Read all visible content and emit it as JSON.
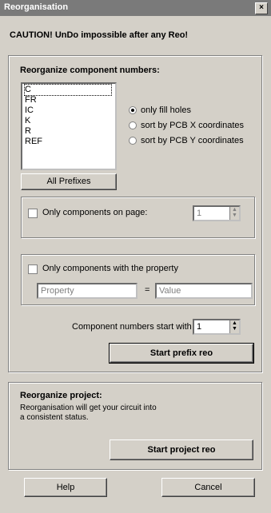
{
  "window": {
    "title": "Reorganisation",
    "close_symbol": "×"
  },
  "warning": "CAUTION! UnDo impossible after any Reo!",
  "component_numbers": {
    "title": "Reorganize component numbers:",
    "prefixes": [
      "C",
      "FR",
      "IC",
      "K",
      "R",
      "REF"
    ],
    "all_prefixes_label": "All Prefixes",
    "radio_options": [
      {
        "label": "only fill holes",
        "checked": true
      },
      {
        "label": "sort by PCB X coordinates",
        "checked": false
      },
      {
        "label": "sort by PCB Y coordinates",
        "checked": false
      }
    ],
    "only_on_page_label": "Only components on page:",
    "page_value": "1",
    "only_with_property_label": "Only components with the property",
    "property_placeholder": "Property",
    "equals": "=",
    "value_placeholder": "Value",
    "start_with_label": "Component numbers start with",
    "start_with_value": "1",
    "start_prefix_button": "Start prefix reo"
  },
  "project": {
    "title": "Reorganize project:",
    "description_line1": "Reorganisation will get your circuit into",
    "description_line2": "a consistent status.",
    "start_project_button": "Start project reo"
  },
  "footer": {
    "help_label": "Help",
    "cancel_label": "Cancel"
  }
}
